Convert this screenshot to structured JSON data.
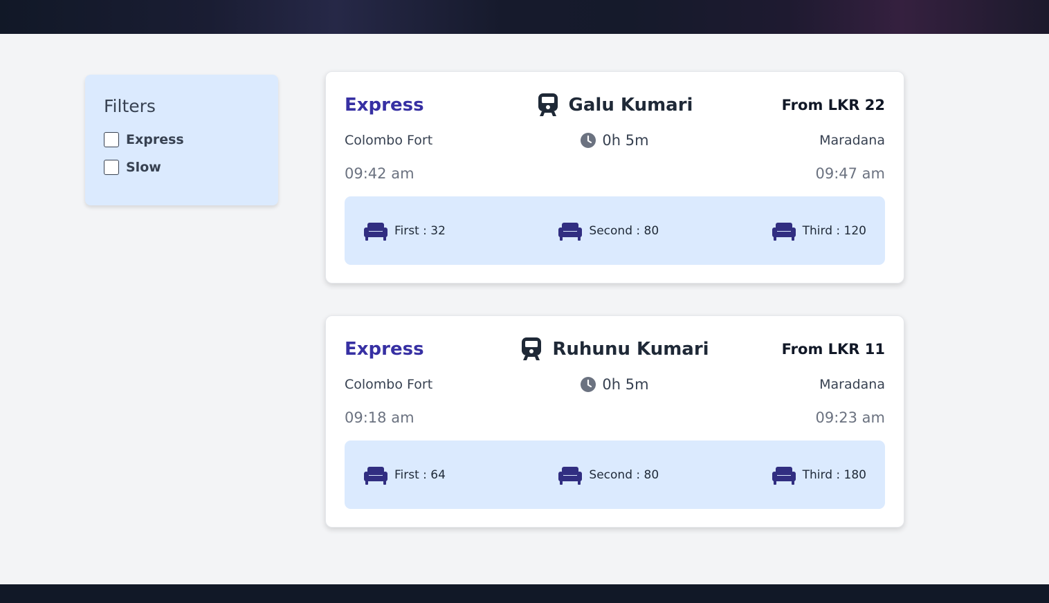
{
  "filters": {
    "title": "Filters",
    "options": [
      {
        "label": "Express",
        "checked": false
      },
      {
        "label": "Slow",
        "checked": false
      }
    ]
  },
  "trains": [
    {
      "type": "Express",
      "name": "Galu Kumari",
      "price": "From LKR 22",
      "from": "Colombo Fort",
      "to": "Maradana",
      "duration": "0h 5m",
      "depart": "09:42 am",
      "arrive": "09:47 am",
      "seats": [
        {
          "label": "First : 32"
        },
        {
          "label": "Second : 80"
        },
        {
          "label": "Third : 120"
        }
      ]
    },
    {
      "type": "Express",
      "name": "Ruhunu Kumari",
      "price": "From LKR 11",
      "from": "Colombo Fort",
      "to": "Maradana",
      "duration": "0h 5m",
      "depart": "09:18 am",
      "arrive": "09:23 am",
      "seats": [
        {
          "label": "First : 64"
        },
        {
          "label": "Second : 80"
        },
        {
          "label": "Third : 180"
        }
      ]
    }
  ],
  "icons": {
    "train": "train-icon",
    "clock": "clock-icon",
    "seat": "sofa-icon"
  },
  "colors": {
    "accent": "#3730a3",
    "seat_icon": "#312e81",
    "panel_bg": "#dbeafe",
    "header_bg": "#111827"
  }
}
